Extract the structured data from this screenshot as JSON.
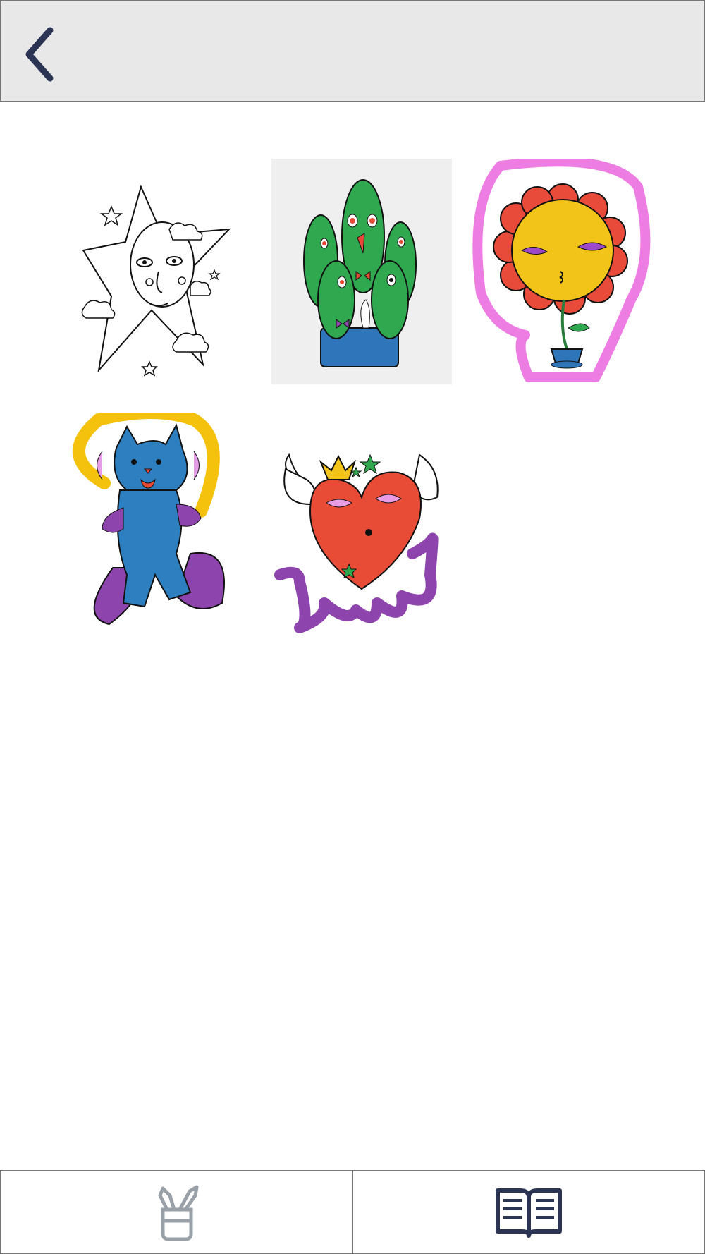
{
  "header": {
    "back_icon": "chevron-left-icon",
    "accent": "#2b3453"
  },
  "gallery": {
    "items": [
      {
        "name": "star-drawing",
        "state": "uncolored"
      },
      {
        "name": "cactus-drawing",
        "state": "colored",
        "selected": true
      },
      {
        "name": "flower-drawing",
        "state": "colored"
      },
      {
        "name": "cat-drawing",
        "state": "colored"
      },
      {
        "name": "heart-drawing",
        "state": "colored"
      }
    ]
  },
  "bottom_nav": {
    "tabs": [
      {
        "name": "paint",
        "icon": "paint-brushes-icon",
        "color": "#9aa0a8"
      },
      {
        "name": "book",
        "icon": "open-book-icon",
        "color": "#2b3453"
      }
    ]
  }
}
